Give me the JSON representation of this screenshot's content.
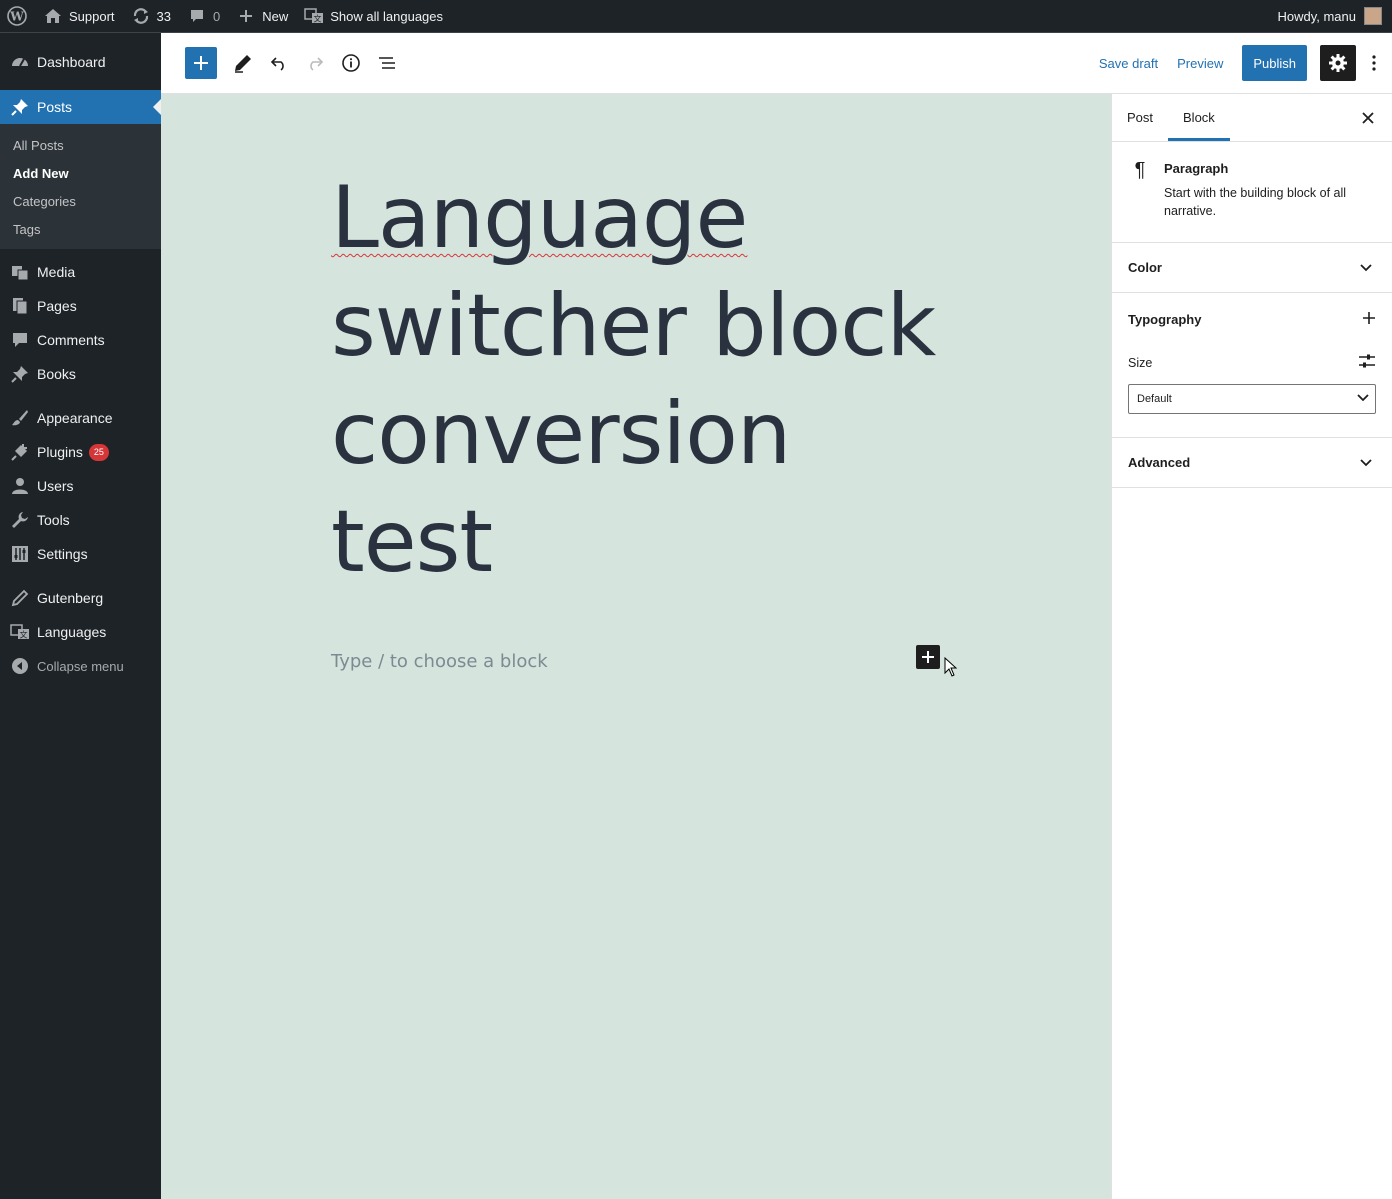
{
  "adminbar": {
    "site_name": "Support",
    "updates_count": "33",
    "comments_count": "0",
    "new_label": "New",
    "languages_label": "Show all languages",
    "howdy": "Howdy, manu"
  },
  "sidebar": {
    "dashboard": "Dashboard",
    "posts": "Posts",
    "posts_sub": [
      "All Posts",
      "Add New",
      "Categories",
      "Tags"
    ],
    "media": "Media",
    "pages": "Pages",
    "comments": "Comments",
    "books": "Books",
    "appearance": "Appearance",
    "plugins": "Plugins",
    "plugins_badge": "25",
    "users": "Users",
    "tools": "Tools",
    "settings": "Settings",
    "gutenberg": "Gutenberg",
    "languages": "Languages",
    "collapse": "Collapse menu"
  },
  "header": {
    "save_draft": "Save draft",
    "preview": "Preview",
    "publish": "Publish"
  },
  "canvas": {
    "title_word1": "Language",
    "title_rest": "switcher block conversion test",
    "placeholder": "Type / to choose a block"
  },
  "inspector": {
    "tab_post": "Post",
    "tab_block": "Block",
    "block_name": "Paragraph",
    "block_desc": "Start with the building block of all narrative.",
    "panel_color": "Color",
    "panel_typography": "Typography",
    "size_label": "Size",
    "size_value": "Default",
    "panel_advanced": "Advanced"
  },
  "colors": {
    "admin_dark": "#1d2327",
    "accent": "#2271b1",
    "canvas_bg": "#d5e4dd"
  }
}
